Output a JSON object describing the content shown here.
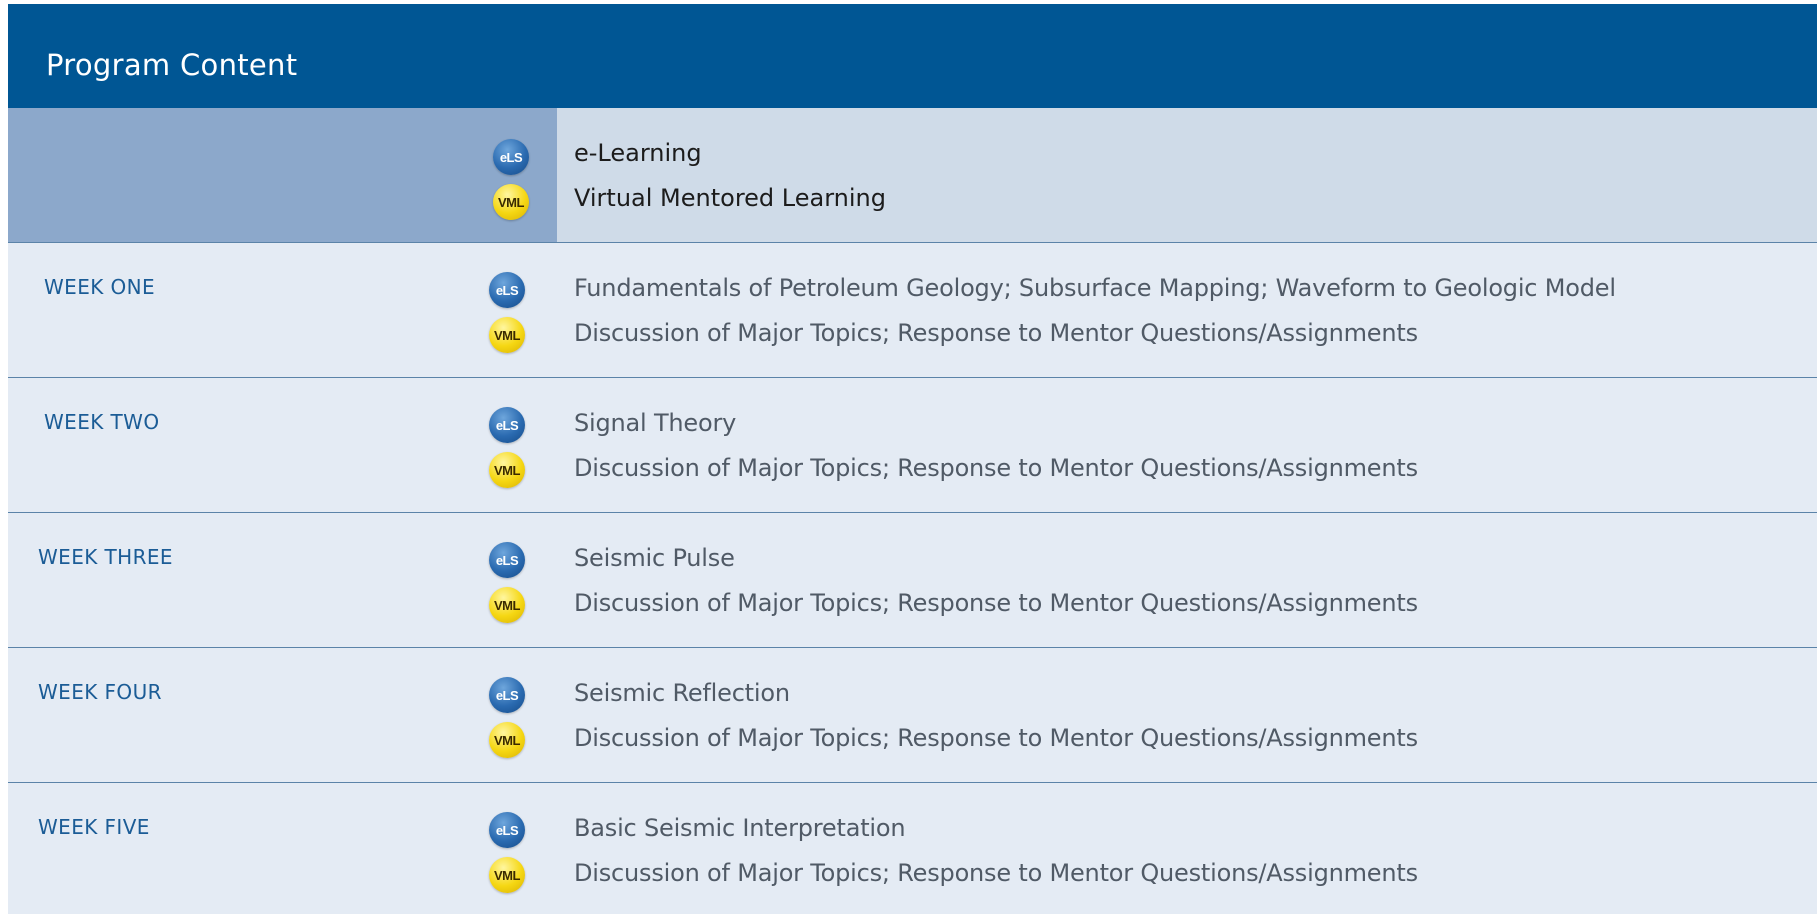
{
  "header": {
    "title": "Program Content"
  },
  "icons": {
    "els_label": "eLS",
    "vml_label": "VML"
  },
  "legend": {
    "els": "e-Learning",
    "vml": "Virtual Mentored Learning"
  },
  "weeks": [
    {
      "label": "WEEK ONE",
      "els": "Fundamentals of Petroleum Geology; Subsurface Mapping; Waveform to Geologic Model",
      "vml": "Discussion of Major Topics; Response to Mentor Questions/Assignments"
    },
    {
      "label": "WEEK TWO",
      "els": "Signal Theory",
      "vml": "Discussion of Major Topics; Response to Mentor Questions/Assignments"
    },
    {
      "label": "WEEK THREE",
      "els": "Seismic Pulse",
      "vml": "Discussion of Major Topics; Response to Mentor Questions/Assignments"
    },
    {
      "label": "WEEK FOUR",
      "els": "Seismic Reflection",
      "vml": "Discussion of Major Topics; Response to Mentor Questions/Assignments"
    },
    {
      "label": "WEEK FIVE",
      "els": "Basic Seismic Interpretation",
      "vml": "Discussion of Major Topics; Response to Mentor Questions/Assignments"
    }
  ]
}
